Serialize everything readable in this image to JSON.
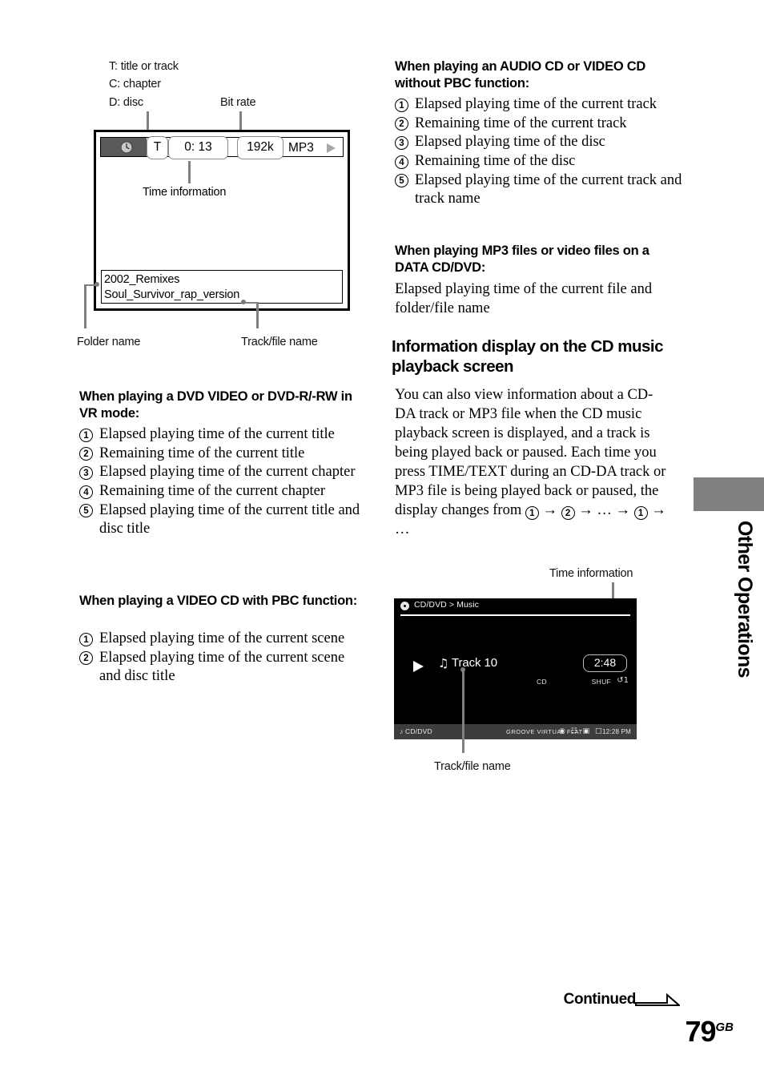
{
  "osd_diagram": {
    "legend_lines": [
      "T: title or track",
      "C: chapter",
      "D: disc"
    ],
    "bit_rate_label": "Bit rate",
    "time_info_label": "Time information",
    "folder_name_label": "Folder name",
    "track_file_name_label": "Track/file name",
    "display": {
      "clock_icon": "clock-icon",
      "type_field": "T",
      "time_field": "0: 13",
      "bit_rate_field": "192k",
      "codec": "MP3",
      "play_icon": "play-triangle-icon",
      "folder_name": "2002_Remixes",
      "track_file_name": "Soul_Survivor_rap_version"
    }
  },
  "left_column": {
    "dvd_section": {
      "heading": "When playing a DVD VIDEO or DVD-R/-RW in VR mode:",
      "items": [
        "Elapsed playing time of the current title",
        "Remaining time of the current title",
        "Elapsed playing time of the current chapter",
        "Remaining time of the current chapter",
        "Elapsed playing time of the current title and disc title"
      ]
    },
    "vcd_pbc_section": {
      "heading": "When playing a VIDEO CD with PBC function:",
      "items": [
        "Elapsed playing time of the current scene",
        "Elapsed playing time of the current scene and disc title"
      ]
    }
  },
  "right_column": {
    "audio_cd_section": {
      "heading": "When playing an AUDIO CD or VIDEO CD without PBC function:",
      "items": [
        "Elapsed playing time of the current track",
        "Remaining time of the current track",
        "Elapsed playing time of the disc",
        "Remaining time of the disc",
        "Elapsed playing time of the current track and track name"
      ]
    },
    "mp3_section": {
      "heading": "When playing MP3 files or video files on a DATA CD/DVD:",
      "body": "Elapsed playing time of the current file and folder/file name"
    },
    "info_display_section": {
      "heading": "Information display on the CD music playback screen",
      "paragraph_part1": "You can also view information about a CD-DA track or MP3 file when the CD music playback screen is displayed, and a track is being played back or paused. Each time you press TIME/TEXT during an CD-DA track or MP3 file is being played back or paused, the display changes from",
      "seq_num_1": "1",
      "seq_num_2": "2",
      "seq_arrow": "→",
      "seq_ellipsis": "…",
      "seq_num_1b": "1",
      "seq_tail_ellipsis": "…"
    }
  },
  "cd_screen": {
    "time_info_label": "Time information",
    "track_file_name_label": "Track/file name",
    "disc_icon": "disc-icon",
    "breadcrumb": "CD/DVD > Music",
    "play_icon": "play-triangle-icon",
    "note_icon": "♫",
    "track_name": "Track 10",
    "time": "2:48",
    "source_label": "CD",
    "shuffle_label": "SHUF",
    "repeat_label": "↺1",
    "status_source_icon": "♪",
    "status_source": "CD/DVD",
    "status_modes": "GROOVE  VIRTUAL  FLAT",
    "status_icons": "◉ ☷ ▣ □",
    "status_time": "12:28 PM"
  },
  "side_tab": {
    "label": "Other Operations",
    "color": "#808080"
  },
  "footer": {
    "continued_label": "Continued",
    "continued_arrow_icon": "long-arrow-right-icon",
    "page_number": "79",
    "page_suffix": "GB"
  }
}
